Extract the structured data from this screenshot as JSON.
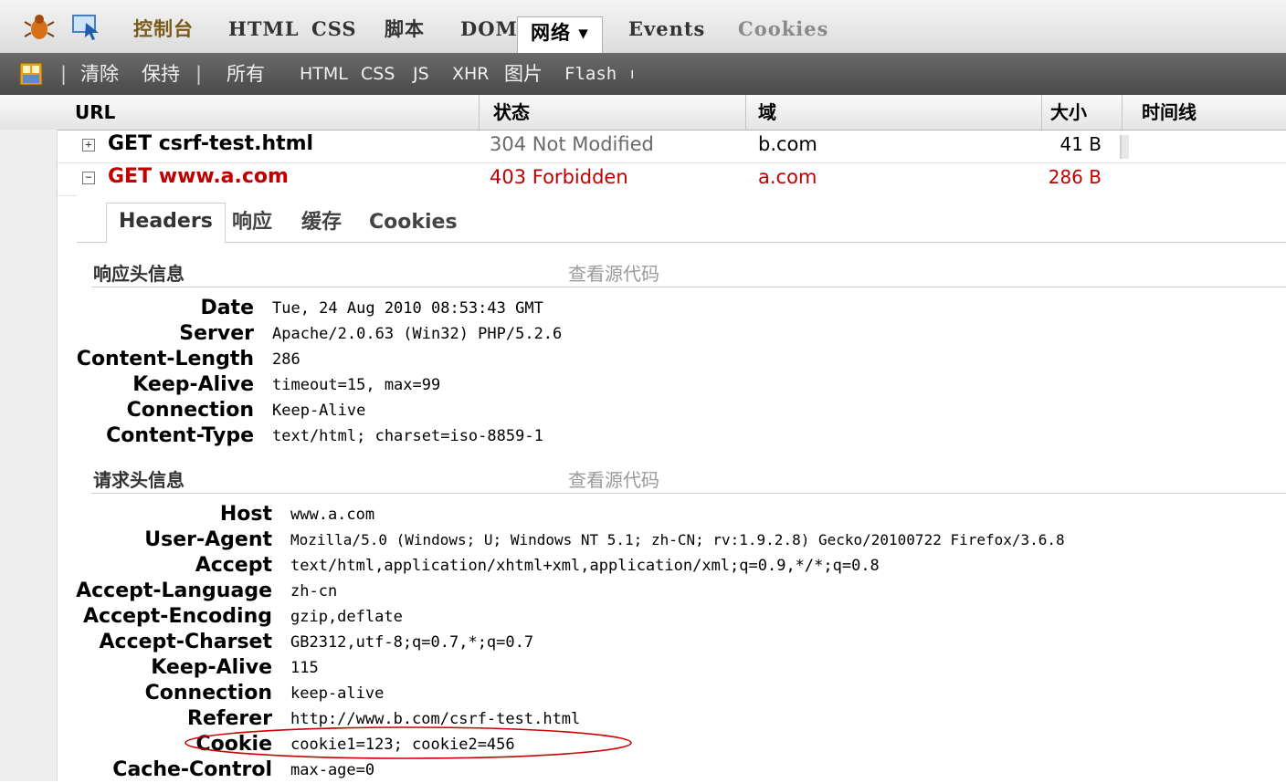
{
  "toolbar": {
    "tabs": [
      {
        "label": "控制台"
      },
      {
        "label": "HTML"
      },
      {
        "label": "CSS"
      },
      {
        "label": "脚本"
      },
      {
        "label": "DOM"
      },
      {
        "label": "网络 ▾"
      },
      {
        "label": "Events"
      },
      {
        "label": "Cookies"
      }
    ],
    "active_tab": "网络 ▾"
  },
  "net_toolbar": {
    "items": [
      "清除",
      "保持",
      "所有",
      "HTML",
      "CSS",
      "JS",
      "XHR",
      "图片",
      "Flash"
    ]
  },
  "table": {
    "columns": [
      "URL",
      "状态",
      "域",
      "大小",
      "时间线"
    ],
    "rows": [
      {
        "toggle": "+",
        "url": "GET csrf-test.html",
        "status": "304 Not Modified",
        "domain": "b.com",
        "size": "41 B"
      },
      {
        "toggle": "−",
        "url": "GET www.a.com",
        "status": "403 Forbidden",
        "domain": "a.com",
        "size": "286 B"
      }
    ]
  },
  "detail": {
    "tabs": [
      "Headers",
      "响应",
      "缓存",
      "Cookies"
    ],
    "response_section": {
      "title": "响应头信息",
      "view_source": "查看源代码",
      "headers": [
        {
          "name": "Date",
          "value": "Tue, 24 Aug 2010 08:53:43 GMT"
        },
        {
          "name": "Server",
          "value": "Apache/2.0.63 (Win32) PHP/5.2.6"
        },
        {
          "name": "Content-Length",
          "value": "286"
        },
        {
          "name": "Keep-Alive",
          "value": "timeout=15, max=99"
        },
        {
          "name": "Connection",
          "value": "Keep-Alive"
        },
        {
          "name": "Content-Type",
          "value": "text/html; charset=iso-8859-1"
        }
      ]
    },
    "request_section": {
      "title": "请求头信息",
      "view_source": "查看源代码",
      "headers": [
        {
          "name": "Host",
          "value": "www.a.com"
        },
        {
          "name": "User-Agent",
          "value": "Mozilla/5.0 (Windows; U; Windows NT 5.1; zh-CN; rv:1.9.2.8) Gecko/20100722 Firefox/3.6.8"
        },
        {
          "name": "Accept",
          "value": "text/html,application/xhtml+xml,application/xml;q=0.9,*/*;q=0.8"
        },
        {
          "name": "Accept-Language",
          "value": "zh-cn"
        },
        {
          "name": "Accept-Encoding",
          "value": "gzip,deflate"
        },
        {
          "name": "Accept-Charset",
          "value": "GB2312,utf-8;q=0.7,*;q=0.7"
        },
        {
          "name": "Keep-Alive",
          "value": "115"
        },
        {
          "name": "Connection",
          "value": "keep-alive"
        },
        {
          "name": "Referer",
          "value": "http://www.b.com/csrf-test.html"
        },
        {
          "name": "Cookie",
          "value": "cookie1=123; cookie2=456"
        },
        {
          "name": "Cache-Control",
          "value": "max-age=0"
        }
      ]
    }
  },
  "colors": {
    "error_red": "#c00000",
    "annotation_red": "#cc0000",
    "toolbar_dark": "#4a4a4a"
  }
}
